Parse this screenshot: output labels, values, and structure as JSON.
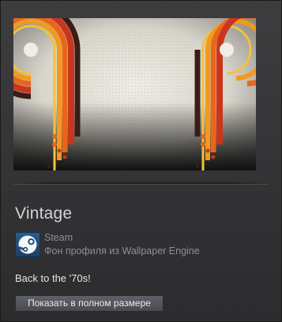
{
  "item": {
    "title": "Vintage",
    "app_name": "Steam",
    "type_label": "Фон профиля из Wallpaper Engine",
    "description": "Back to the '70s!",
    "full_size_button": "Показать в полном размере"
  },
  "icons": {
    "app_icon": "steam-logo-icon"
  },
  "colors": {
    "panel_bg": "#3a3a3c",
    "title": "#d3d3d5",
    "muted_text": "#8d8f93",
    "button_bg": "#54575c",
    "steam_blue": "#2a5d8c"
  }
}
